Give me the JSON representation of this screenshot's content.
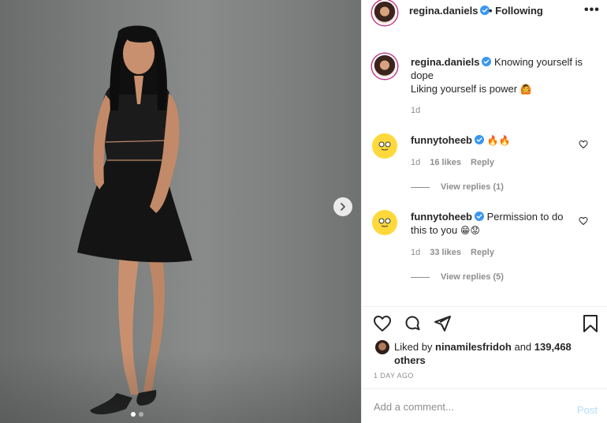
{
  "post": {
    "username": "regina.daniels",
    "follow_status": "Following",
    "more_label": "•••",
    "photo": {
      "description_icon": "photo-of-woman-in-black-dress",
      "dots_count": 2,
      "active_dot": 0
    }
  },
  "caption": {
    "username": "regina.daniels",
    "line1": "Knowing yourself is dope",
    "line2": "Liking yourself is power",
    "emoji": "🙆",
    "time": "1d"
  },
  "comments": [
    {
      "username": "funnytoheeb",
      "text": "",
      "emoji": "🔥🔥",
      "time": "1d",
      "likes": "16 likes",
      "reply": "Reply",
      "view_replies": "View replies (1)"
    },
    {
      "username": "funnytoheeb",
      "text": "Permission to do this to you",
      "emoji": "😁😟",
      "time": "1d",
      "likes": "33 likes",
      "reply": "Reply",
      "view_replies": "View replies (5)"
    }
  ],
  "likes": {
    "liked_by_prefix": "Liked by",
    "liked_by_user": "ninamilesfridoh",
    "and": "and",
    "others": "139,468 others"
  },
  "post_time": "1 DAY AGO",
  "add_comment": {
    "placeholder": "Add a comment...",
    "post_label": "Post"
  },
  "colors": {
    "verified": "#3897f0",
    "post_disabled": "#b2dffc",
    "muted": "#8e8e8e"
  }
}
